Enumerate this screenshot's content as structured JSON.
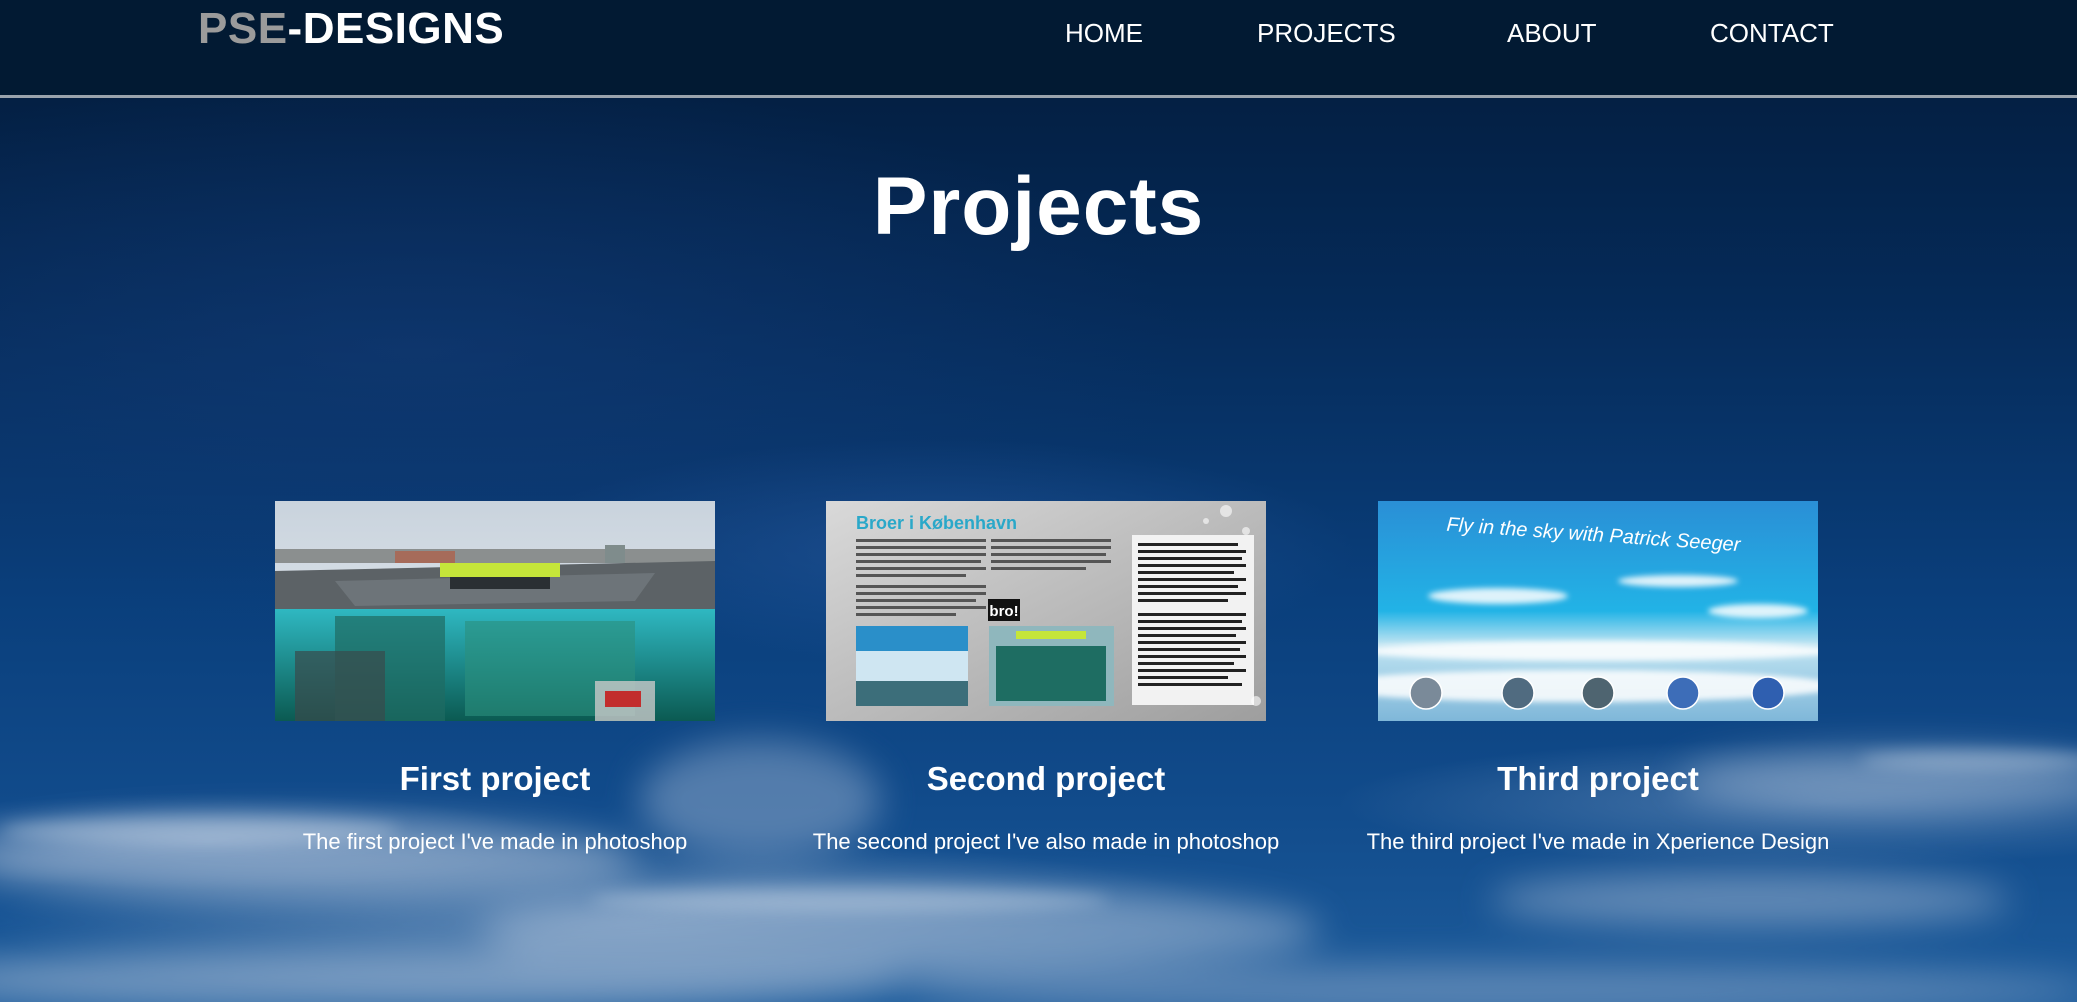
{
  "nav": {
    "logo_part1": "PSE",
    "logo_part2": "-DESIGNS",
    "links": [
      {
        "label": "HOME"
      },
      {
        "label": "PROJECTS"
      },
      {
        "label": "ABOUT"
      },
      {
        "label": "CONTACT"
      }
    ]
  },
  "main": {
    "title": "Projects",
    "projects": [
      {
        "title": "First project",
        "description": "The first project I've made in photoshop"
      },
      {
        "title": "Second project",
        "description": "The second project I've also made in photoshop",
        "thumb_heading": "Broer i København",
        "thumb_badge": "bro!"
      },
      {
        "title": "Third project",
        "description": "The third project I've made in Xperience Design",
        "thumb_heading": "Fly in the sky with Patrick Seeger"
      }
    ]
  },
  "colors": {
    "nav_background": "#021a33",
    "nav_border": "#9aa3ad",
    "logo_grey": "#9b9b9b",
    "text": "#ffffff",
    "sky_top": "#031b3a",
    "sky_bottom": "#1d5c9c"
  }
}
